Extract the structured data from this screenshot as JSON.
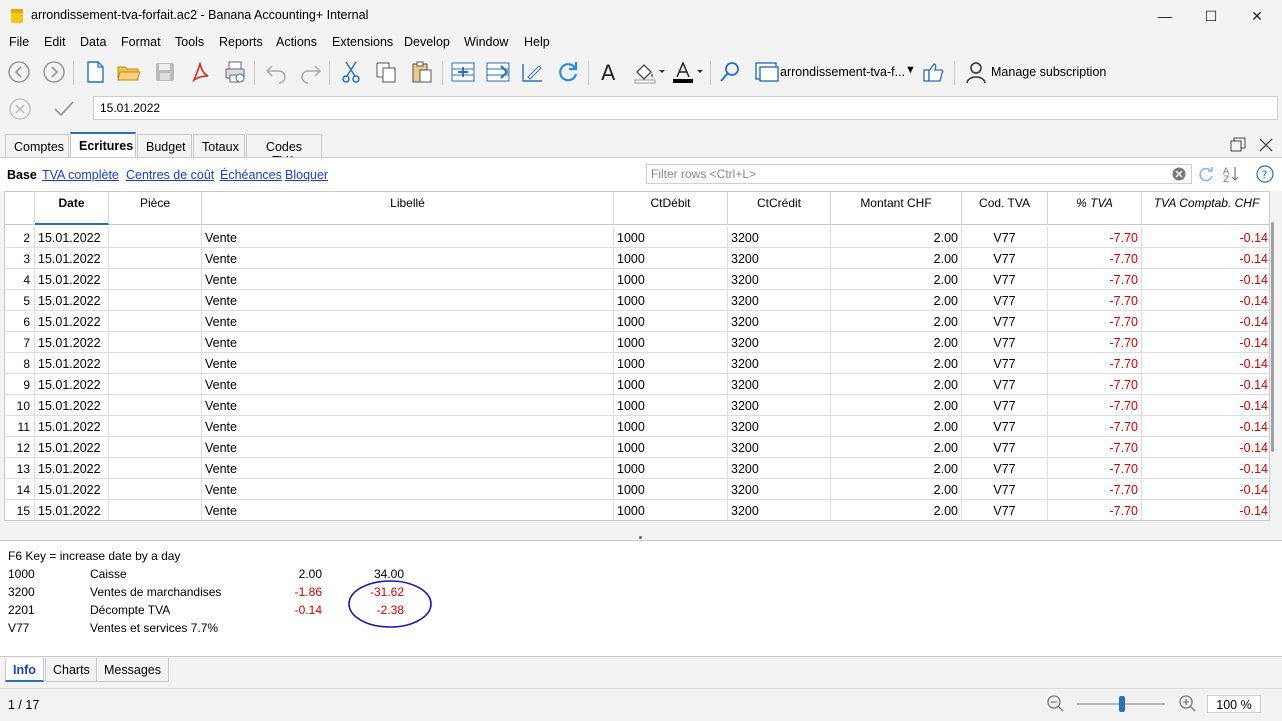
{
  "window": {
    "title": "arrondissement-tva-forfait.ac2 - Banana Accounting+ Internal",
    "minimize": "—",
    "maximize": "☐",
    "close": "✕"
  },
  "menu": [
    "File",
    "Edit",
    "Data",
    "Format",
    "Tools",
    "Reports",
    "Actions",
    "Extensions",
    "Develop",
    "Window",
    "Help"
  ],
  "toolbar": {
    "file_selector": "arrondissement-tva-f...",
    "manage_subscription": "Manage subscription"
  },
  "editbar": {
    "value": "15.01.2022"
  },
  "tabs": [
    "Comptes",
    "Ecritures",
    "Budget",
    "Totaux",
    "Codes TVA"
  ],
  "active_tab": "Ecritures",
  "views": {
    "base": "Base",
    "links": [
      "TVA complète",
      "Centres de coût",
      "Échéances",
      "Bloquer"
    ],
    "filter_placeholder": "Filter rows <Ctrl+L>"
  },
  "table": {
    "columns": [
      "Date",
      "Pièce",
      "Libellé",
      "CtDébit",
      "CtCrédit",
      "Montant CHF",
      "Cod. TVA",
      "% TVA",
      "TVA Comptab. CHF"
    ],
    "rows": [
      {
        "n": "2",
        "date": "15.01.2022",
        "piece": "",
        "libelle": "Vente",
        "debit": "1000",
        "credit": "3200",
        "montant": "2.00",
        "code": "V77",
        "pct": "-7.70",
        "tva": "-0.14"
      },
      {
        "n": "3",
        "date": "15.01.2022",
        "piece": "",
        "libelle": "Vente",
        "debit": "1000",
        "credit": "3200",
        "montant": "2.00",
        "code": "V77",
        "pct": "-7.70",
        "tva": "-0.14"
      },
      {
        "n": "4",
        "date": "15.01.2022",
        "piece": "",
        "libelle": "Vente",
        "debit": "1000",
        "credit": "3200",
        "montant": "2.00",
        "code": "V77",
        "pct": "-7.70",
        "tva": "-0.14"
      },
      {
        "n": "5",
        "date": "15.01.2022",
        "piece": "",
        "libelle": "Vente",
        "debit": "1000",
        "credit": "3200",
        "montant": "2.00",
        "code": "V77",
        "pct": "-7.70",
        "tva": "-0.14"
      },
      {
        "n": "6",
        "date": "15.01.2022",
        "piece": "",
        "libelle": "Vente",
        "debit": "1000",
        "credit": "3200",
        "montant": "2.00",
        "code": "V77",
        "pct": "-7.70",
        "tva": "-0.14"
      },
      {
        "n": "7",
        "date": "15.01.2022",
        "piece": "",
        "libelle": "Vente",
        "debit": "1000",
        "credit": "3200",
        "montant": "2.00",
        "code": "V77",
        "pct": "-7.70",
        "tva": "-0.14"
      },
      {
        "n": "8",
        "date": "15.01.2022",
        "piece": "",
        "libelle": "Vente",
        "debit": "1000",
        "credit": "3200",
        "montant": "2.00",
        "code": "V77",
        "pct": "-7.70",
        "tva": "-0.14"
      },
      {
        "n": "9",
        "date": "15.01.2022",
        "piece": "",
        "libelle": "Vente",
        "debit": "1000",
        "credit": "3200",
        "montant": "2.00",
        "code": "V77",
        "pct": "-7.70",
        "tva": "-0.14"
      },
      {
        "n": "10",
        "date": "15.01.2022",
        "piece": "",
        "libelle": "Vente",
        "debit": "1000",
        "credit": "3200",
        "montant": "2.00",
        "code": "V77",
        "pct": "-7.70",
        "tva": "-0.14"
      },
      {
        "n": "11",
        "date": "15.01.2022",
        "piece": "",
        "libelle": "Vente",
        "debit": "1000",
        "credit": "3200",
        "montant": "2.00",
        "code": "V77",
        "pct": "-7.70",
        "tva": "-0.14"
      },
      {
        "n": "12",
        "date": "15.01.2022",
        "piece": "",
        "libelle": "Vente",
        "debit": "1000",
        "credit": "3200",
        "montant": "2.00",
        "code": "V77",
        "pct": "-7.70",
        "tva": "-0.14"
      },
      {
        "n": "13",
        "date": "15.01.2022",
        "piece": "",
        "libelle": "Vente",
        "debit": "1000",
        "credit": "3200",
        "montant": "2.00",
        "code": "V77",
        "pct": "-7.70",
        "tva": "-0.14"
      },
      {
        "n": "14",
        "date": "15.01.2022",
        "piece": "",
        "libelle": "Vente",
        "debit": "1000",
        "credit": "3200",
        "montant": "2.00",
        "code": "V77",
        "pct": "-7.70",
        "tva": "-0.14"
      },
      {
        "n": "15",
        "date": "15.01.2022",
        "piece": "",
        "libelle": "Vente",
        "debit": "1000",
        "credit": "3200",
        "montant": "2.00",
        "code": "V77",
        "pct": "-7.70",
        "tva": "-0.14"
      }
    ]
  },
  "info": {
    "hint": "F6 Key = increase date by a day",
    "lines": [
      {
        "code": "1000",
        "label": "Caisse",
        "amount": "2.00",
        "total": "34.00",
        "neg": false
      },
      {
        "code": "3200",
        "label": "Ventes de marchandises",
        "amount": "-1.86",
        "total": "-31.62",
        "neg": true
      },
      {
        "code": "2201",
        "label": "Décompte TVA",
        "amount": "-0.14",
        "total": "-2.38",
        "neg": true
      },
      {
        "code": "V77",
        "label": "Ventes et services 7.7%",
        "amount": "",
        "total": "",
        "neg": false
      }
    ]
  },
  "bottom_tabs": [
    "Info",
    "Charts",
    "Messages"
  ],
  "status": {
    "position": "1 / 17",
    "zoom": "100 %"
  },
  "colors": {
    "accent": "#2a6fb8",
    "negative": "#d10000",
    "link": "#1d3fc2",
    "annotation": "#1a1aa8"
  }
}
